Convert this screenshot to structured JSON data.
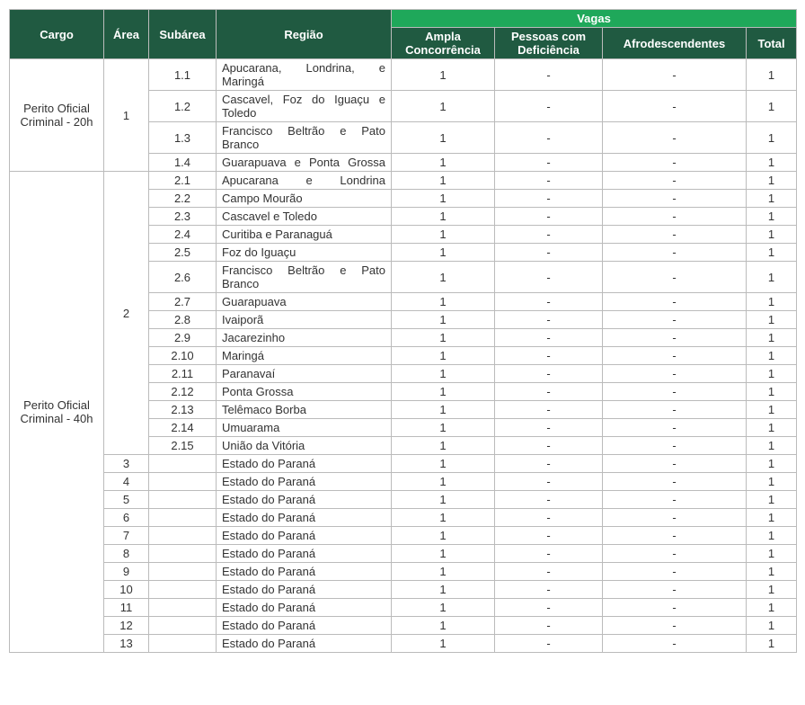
{
  "headers": {
    "cargo": "Cargo",
    "area": "Área",
    "subarea": "Subárea",
    "regiao": "Região",
    "vagas": "Vagas",
    "v_ampla": "Ampla Concorrência",
    "v_pcd": "Pessoas com Deficiência",
    "v_afro": "Afrodescendentes",
    "v_total": "Total"
  },
  "groups": [
    {
      "cargo": "Perito Oficial Criminal - 20h",
      "areas": [
        {
          "area": "1",
          "rows": [
            {
              "subarea": "1.1",
              "regiao": "Apucarana, Londrina, e Maringá",
              "just": true,
              "v1": "1",
              "v2": "-",
              "v3": "-",
              "v4": "1"
            },
            {
              "subarea": "1.2",
              "regiao": "Cascavel, Foz do Iguaçu e Toledo",
              "just": true,
              "v1": "1",
              "v2": "-",
              "v3": "-",
              "v4": "1"
            },
            {
              "subarea": "1.3",
              "regiao": "Francisco Beltrão e Pato Branco",
              "just": true,
              "v1": "1",
              "v2": "-",
              "v3": "-",
              "v4": "1"
            },
            {
              "subarea": "1.4",
              "regiao": "Guarapuava e Ponta Grossa",
              "just": true,
              "v1": "1",
              "v2": "-",
              "v3": "-",
              "v4": "1"
            }
          ]
        }
      ]
    },
    {
      "cargo": "Perito Oficial Criminal - 40h",
      "areas": [
        {
          "area": "2",
          "rows": [
            {
              "subarea": "2.1",
              "regiao": "Apucarana e Londrina",
              "just": true,
              "v1": "1",
              "v2": "-",
              "v3": "-",
              "v4": "1"
            },
            {
              "subarea": "2.2",
              "regiao": "Campo Mourão",
              "v1": "1",
              "v2": "-",
              "v3": "-",
              "v4": "1"
            },
            {
              "subarea": "2.3",
              "regiao": "Cascavel e Toledo",
              "v1": "1",
              "v2": "-",
              "v3": "-",
              "v4": "1"
            },
            {
              "subarea": "2.4",
              "regiao": "Curitiba e Paranaguá",
              "v1": "1",
              "v2": "-",
              "v3": "-",
              "v4": "1"
            },
            {
              "subarea": "2.5",
              "regiao": "Foz do Iguaçu",
              "v1": "1",
              "v2": "-",
              "v3": "-",
              "v4": "1"
            },
            {
              "subarea": "2.6",
              "regiao": "Francisco Beltrão e Pato Branco",
              "just": true,
              "v1": "1",
              "v2": "-",
              "v3": "-",
              "v4": "1"
            },
            {
              "subarea": "2.7",
              "regiao": "Guarapuava",
              "v1": "1",
              "v2": "-",
              "v3": "-",
              "v4": "1"
            },
            {
              "subarea": "2.8",
              "regiao": "Ivaiporã",
              "v1": "1",
              "v2": "-",
              "v3": "-",
              "v4": "1"
            },
            {
              "subarea": "2.9",
              "regiao": "Jacarezinho",
              "v1": "1",
              "v2": "-",
              "v3": "-",
              "v4": "1"
            },
            {
              "subarea": "2.10",
              "regiao": "Maringá",
              "v1": "1",
              "v2": "-",
              "v3": "-",
              "v4": "1"
            },
            {
              "subarea": "2.11",
              "regiao": "Paranavaí",
              "v1": "1",
              "v2": "-",
              "v3": "-",
              "v4": "1"
            },
            {
              "subarea": "2.12",
              "regiao": "Ponta Grossa",
              "v1": "1",
              "v2": "-",
              "v3": "-",
              "v4": "1"
            },
            {
              "subarea": "2.13",
              "regiao": "Telêmaco Borba",
              "v1": "1",
              "v2": "-",
              "v3": "-",
              "v4": "1"
            },
            {
              "subarea": "2.14",
              "regiao": "Umuarama",
              "v1": "1",
              "v2": "-",
              "v3": "-",
              "v4": "1"
            },
            {
              "subarea": "2.15",
              "regiao": "União da Vitória",
              "v1": "1",
              "v2": "-",
              "v3": "-",
              "v4": "1"
            }
          ]
        },
        {
          "area": "3",
          "rows": [
            {
              "subarea": "",
              "regiao": "Estado do Paraná",
              "v1": "1",
              "v2": "-",
              "v3": "-",
              "v4": "1"
            }
          ]
        },
        {
          "area": "4",
          "rows": [
            {
              "subarea": "",
              "regiao": "Estado do Paraná",
              "v1": "1",
              "v2": "-",
              "v3": "-",
              "v4": "1"
            }
          ]
        },
        {
          "area": "5",
          "rows": [
            {
              "subarea": "",
              "regiao": "Estado do Paraná",
              "v1": "1",
              "v2": "-",
              "v3": "-",
              "v4": "1"
            }
          ]
        },
        {
          "area": "6",
          "rows": [
            {
              "subarea": "",
              "regiao": "Estado do Paraná",
              "v1": "1",
              "v2": "-",
              "v3": "-",
              "v4": "1"
            }
          ]
        },
        {
          "area": "7",
          "rows": [
            {
              "subarea": "",
              "regiao": "Estado do Paraná",
              "v1": "1",
              "v2": "-",
              "v3": "-",
              "v4": "1"
            }
          ]
        },
        {
          "area": "8",
          "rows": [
            {
              "subarea": "",
              "regiao": "Estado do Paraná",
              "v1": "1",
              "v2": "-",
              "v3": "-",
              "v4": "1"
            }
          ]
        },
        {
          "area": "9",
          "rows": [
            {
              "subarea": "",
              "regiao": "Estado do Paraná",
              "v1": "1",
              "v2": "-",
              "v3": "-",
              "v4": "1"
            }
          ]
        },
        {
          "area": "10",
          "rows": [
            {
              "subarea": "",
              "regiao": "Estado do Paraná",
              "v1": "1",
              "v2": "-",
              "v3": "-",
              "v4": "1"
            }
          ]
        },
        {
          "area": "11",
          "rows": [
            {
              "subarea": "",
              "regiao": "Estado do Paraná",
              "v1": "1",
              "v2": "-",
              "v3": "-",
              "v4": "1"
            }
          ]
        },
        {
          "area": "12",
          "rows": [
            {
              "subarea": "",
              "regiao": "Estado do Paraná",
              "v1": "1",
              "v2": "-",
              "v3": "-",
              "v4": "1"
            }
          ]
        },
        {
          "area": "13",
          "rows": [
            {
              "subarea": "",
              "regiao": "Estado do Paraná",
              "v1": "1",
              "v2": "-",
              "v3": "-",
              "v4": "1"
            }
          ]
        }
      ]
    }
  ]
}
